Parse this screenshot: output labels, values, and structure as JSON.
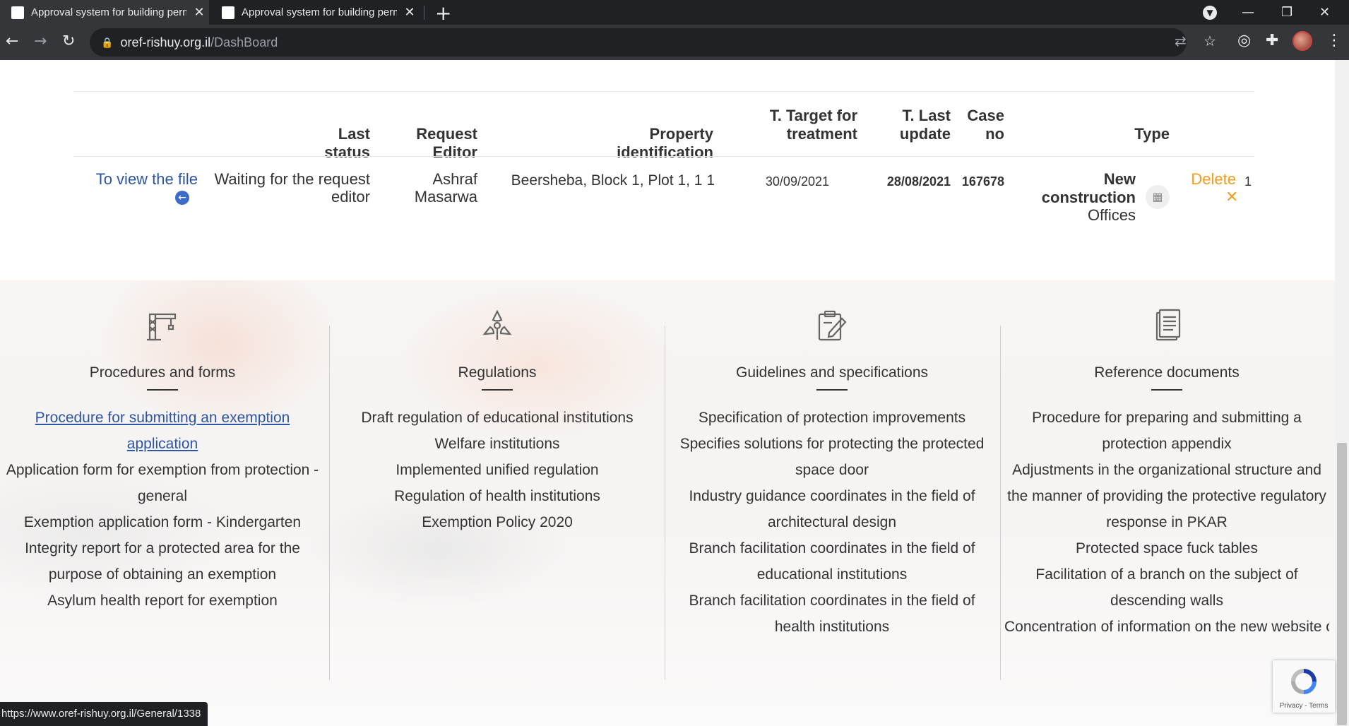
{
  "browser": {
    "tabs": [
      {
        "title": "Approval system for building permits"
      },
      {
        "title": "Approval system for building permits"
      }
    ],
    "address": {
      "host": "oref-rishuy.org.il",
      "path": "/DashBoard"
    },
    "status_url": "https://www.oref-rishuy.org.il/General/1338"
  },
  "table": {
    "headers": {
      "last_status": "Last status",
      "request_editor": "Request Editor",
      "property_identification": "Property identification",
      "target_l1": "T. Target for",
      "target_l2": "treatment",
      "last_update_l1": "T. Last",
      "last_update_l2": "update",
      "case_l1": "Case",
      "case_l2": "no",
      "type": "Type"
    },
    "row": {
      "view_file": "To view the file",
      "status_l1": "Waiting for the request",
      "status_l2": "editor",
      "editor_l1": "Ashraf",
      "editor_l2": "Masarwa",
      "property": "Beersheba, Block 1, Plot 1, 1 1",
      "target_date": "30/09/2021",
      "last_update": "28/08/2021",
      "case_no": "167678",
      "type_l1": "New",
      "type_l2": "construction",
      "type_l3": "Offices",
      "delete": "Delete",
      "index": "1"
    }
  },
  "footer": {
    "columns": [
      {
        "title": "Procedures and forms",
        "icon": "crane-icon",
        "items": [
          "Procedure for submitting an exemption application",
          "Application form for exemption from protection - general",
          "Exemption application form - Kindergarten",
          "Integrity report for a protected area for the purpose of obtaining an exemption",
          "Asylum health report for exemption"
        ]
      },
      {
        "title": "Regulations",
        "icon": "radiation-icon",
        "items": [
          "Draft regulation of educational institutions",
          "Welfare institutions",
          "Implemented unified regulation",
          "Regulation of health institutions",
          "Exemption Policy 2020"
        ]
      },
      {
        "title": "Guidelines and specifications",
        "icon": "clipboard-edit-icon",
        "items": [
          "Specification of protection improvements",
          "Specifies solutions for protecting the protected space door",
          "Industry guidance coordinates in the field of architectural design",
          "Branch facilitation coordinates in the field of educational institutions",
          "Branch facilitation coordinates in the field of health institutions"
        ]
      },
      {
        "title": "Reference documents",
        "icon": "document-icon",
        "items": [
          "Procedure for preparing and submitting a protection appendix",
          "Adjustments in the organizational structure and the manner of providing the protective regulatory response in PKAR",
          "Protected space fuck tables",
          "Facilitation of a branch on the subject of descending walls",
          "Concentration of information on the new website of the National Emergency P"
        ]
      }
    ]
  },
  "recaptcha": {
    "label": "Privacy - Terms"
  }
}
